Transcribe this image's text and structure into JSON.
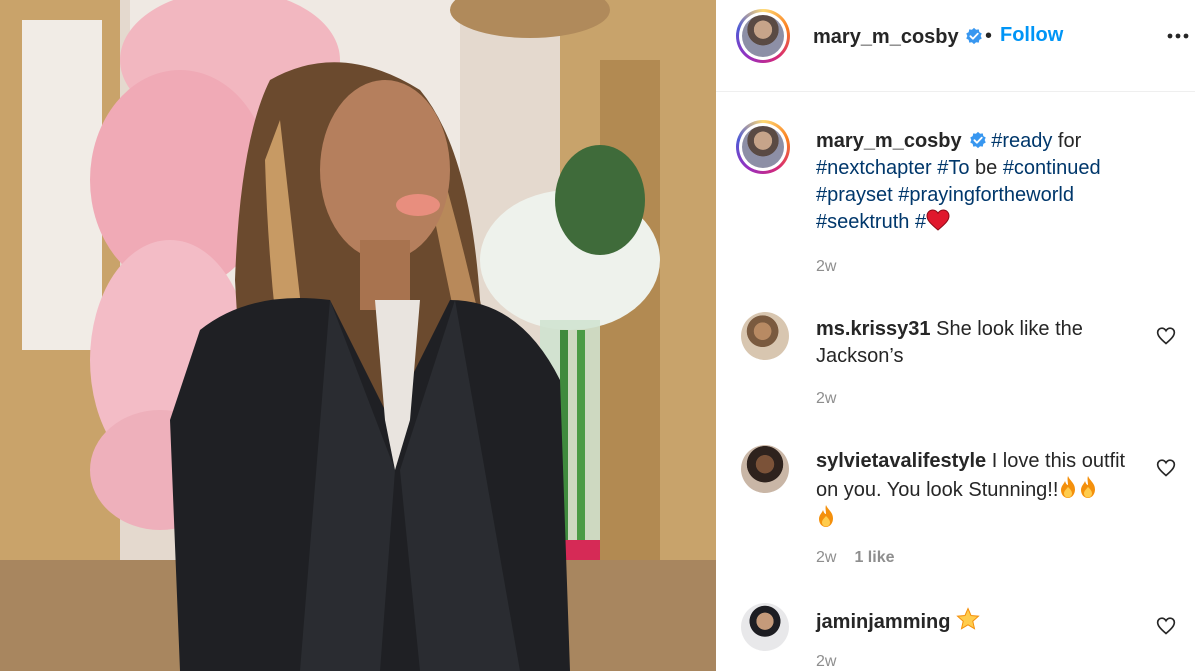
{
  "post": {
    "username": "mary_m_cosby",
    "separator": "•",
    "follow_label": "Follow",
    "caption": {
      "username": "mary_m_cosby",
      "segments": [
        {
          "t": "#ready",
          "tag": true
        },
        {
          "t": " for ",
          "tag": false
        },
        {
          "t": "#nextchapter",
          "tag": true
        },
        {
          "t": " ",
          "tag": false
        },
        {
          "t": "#To",
          "tag": true
        },
        {
          "t": " be ",
          "tag": false
        },
        {
          "t": "#continued",
          "tag": true
        },
        {
          "t": " ",
          "tag": false
        },
        {
          "t": "#prayset",
          "tag": true
        },
        {
          "t": " ",
          "tag": false
        },
        {
          "t": "#prayingfortheworld",
          "tag": true
        },
        {
          "t": " ",
          "tag": false
        },
        {
          "t": "#seektruth",
          "tag": true
        },
        {
          "t": " ",
          "tag": false
        },
        {
          "t": "#",
          "tag": true
        }
      ],
      "time": "2w"
    }
  },
  "comments": [
    {
      "username": "ms.krissy31",
      "text": "She look like the Jackson’s",
      "time": "2w",
      "likes": ""
    },
    {
      "username": "sylvietavalifestyle",
      "text": "I love this outfit on you. You look Stunning!!",
      "time": "2w",
      "likes": "1 like"
    },
    {
      "username": "jaminjamming",
      "text": "",
      "time": "2w",
      "likes": ""
    }
  ],
  "colors": {
    "follow": "#0095f6",
    "hashtag": "#00376b",
    "muted": "#8e8e8e",
    "verified": "#3897f0"
  },
  "icons": [
    "verified-badge-icon",
    "more-options-icon",
    "heart-icon",
    "red-heart-emoji",
    "fire-emoji",
    "star-emoji"
  ]
}
